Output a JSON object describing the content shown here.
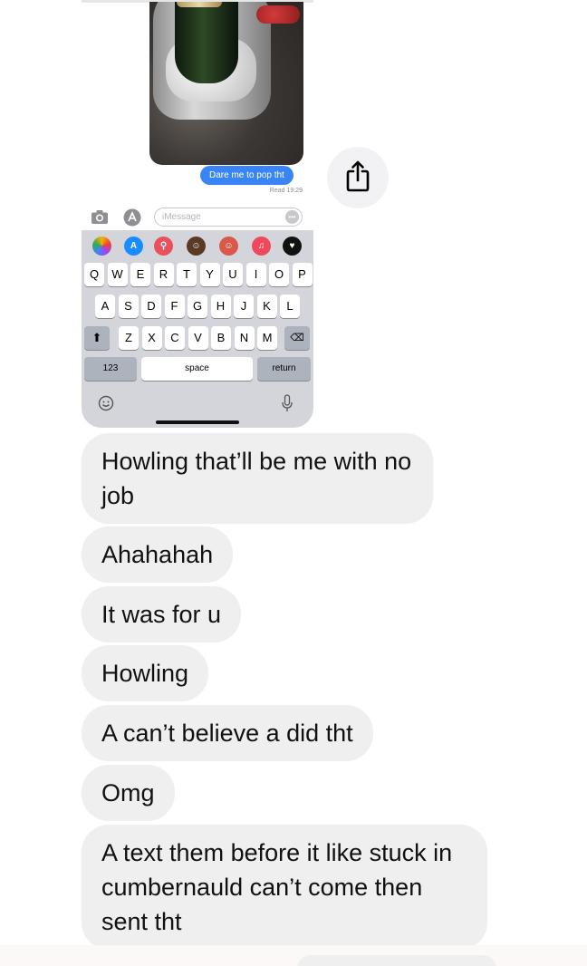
{
  "embedded": {
    "sent_message": "Dare me to pop tht",
    "read_receipt": "Read 19:29",
    "compose_placeholder": "iMessage",
    "app_row": [
      "photos",
      "app-store",
      "search",
      "memoji",
      "memoji",
      "music",
      "digital-touch"
    ],
    "keyboard": {
      "row1": [
        "Q",
        "W",
        "E",
        "R",
        "T",
        "Y",
        "U",
        "I",
        "O",
        "P"
      ],
      "row2": [
        "A",
        "S",
        "D",
        "F",
        "G",
        "H",
        "J",
        "K",
        "L"
      ],
      "row3": [
        "Z",
        "X",
        "C",
        "V",
        "B",
        "N",
        "M"
      ],
      "numbers_label": "123",
      "space_label": "space",
      "return_label": "return"
    }
  },
  "icons": {
    "share": "share-icon",
    "camera": "camera-icon",
    "apps": "apps-icon",
    "emoji": "emoji-icon",
    "mic": "mic-icon"
  },
  "messages": [
    {
      "text": "Howling that’ll be me with no job"
    },
    {
      "text": "Ahahahah"
    },
    {
      "text": "It was for u"
    },
    {
      "text": "Howling"
    },
    {
      "text": "A can’t believe a did tht"
    },
    {
      "text": "Omg"
    },
    {
      "text": "A text them before it like stuck in cumbernauld can’t come then sent tht"
    }
  ],
  "colors": {
    "sent_bubble": "#3a85f5",
    "received_bubble": "#efeff0",
    "keyboard_bg": "#d3d5db"
  }
}
